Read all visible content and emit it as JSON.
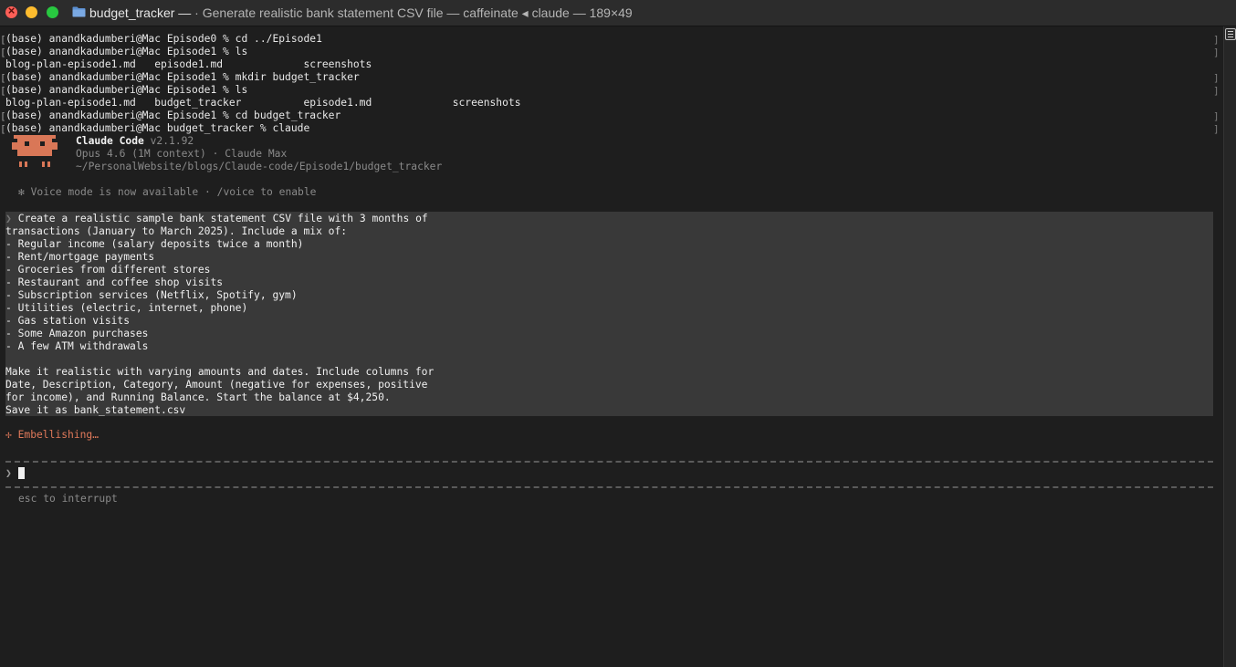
{
  "window": {
    "title_folder": "budget_tracker —",
    "title_rest": " · Generate realistic bank statement CSV file — caffeinate ◂ claude — 189×49"
  },
  "history": [
    "(base) anandkadumberi@Mac Episode0 % cd ../Episode1",
    "(base) anandkadumberi@Mac Episode1 % ls",
    "blog-plan-episode1.md   episode1.md             screenshots",
    "(base) anandkadumberi@Mac Episode1 % mkdir budget_tracker",
    "(base) anandkadumberi@Mac Episode1 % ls",
    "blog-plan-episode1.md   budget_tracker          episode1.md             screenshots",
    "(base) anandkadumberi@Mac Episode1 % cd budget_tracker",
    "(base) anandkadumberi@Mac budget_tracker % claude"
  ],
  "claude_header": {
    "name": "Claude Code",
    "version": " v2.1.92",
    "model": "Opus 4.6 (1M context) · Claude Max",
    "path": "~/PersonalWebsite/blogs/Claude-code/Episode1/budget_tracker"
  },
  "notice": "✻ Voice mode is now available · /voice to enable",
  "prompt": {
    "caret": "❯",
    "lines": [
      " Create a realistic sample bank statement CSV file with 3 months of",
      "transactions (January to March 2025). Include a mix of:",
      "- Regular income (salary deposits twice a month)",
      "- Rent/mortgage payments",
      "- Groceries from different stores",
      "- Restaurant and coffee shop visits",
      "- Subscription services (Netflix, Spotify, gym)",
      "- Utilities (electric, internet, phone)",
      "- Gas station visits",
      "- Some Amazon purchases",
      "- A few ATM withdrawals",
      "",
      "Make it realistic with varying amounts and dates. Include columns for",
      "Date, Description, Category, Amount (negative for expenses, positive",
      "for income), and Running Balance. Start the balance at $4,250.",
      "Save it as bank_statement.csv"
    ]
  },
  "status": "✢ Embellishing…",
  "input_caret": "❯",
  "hint": "esc to interrupt",
  "colors": {
    "accent": "#e0795a",
    "logo": "#d97757",
    "background": "#1e1e1e"
  }
}
